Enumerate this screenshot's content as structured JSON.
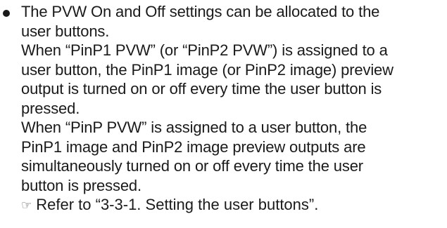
{
  "bullet": {
    "para1": [
      "The PVW On and Off settings can be allocated to the",
      "user buttons."
    ],
    "para2": [
      "When “PinP1 PVW” (or “PinP2 PVW”) is assigned to a",
      "user button, the PinP1 image (or PinP2 image) preview",
      "output is turned on or off every time the user button is",
      "pressed."
    ],
    "para3": [
      "When “PinP PVW” is assigned to a user button, the",
      "PinP1 image and PinP2 image preview outputs are",
      "simultaneously turned on or off every time the user",
      "button is pressed."
    ],
    "reference": {
      "icon": "pointing-hand-icon",
      "text": "Refer to “3-3-1. Setting the user buttons”."
    }
  }
}
